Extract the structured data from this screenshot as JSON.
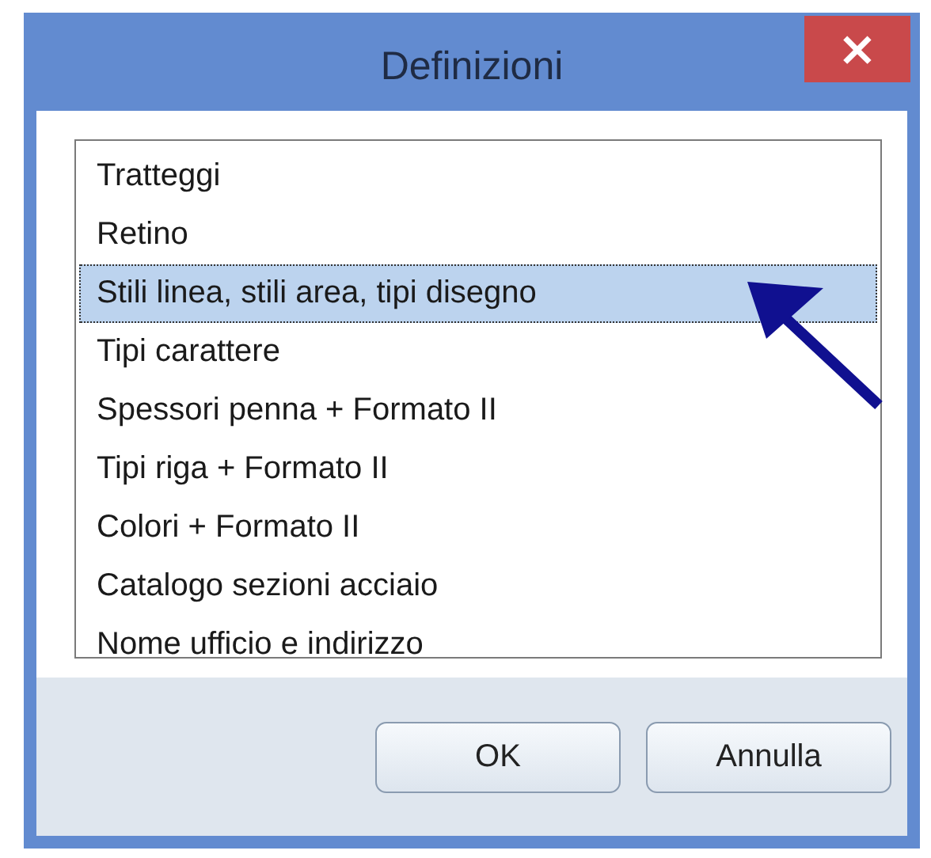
{
  "window": {
    "title": "Definizioni",
    "close": "×"
  },
  "list": {
    "items": [
      {
        "label": "Tratteggi",
        "selected": false
      },
      {
        "label": "Retino",
        "selected": false
      },
      {
        "label": "Stili linea, stili area, tipi disegno",
        "selected": true
      },
      {
        "label": "Tipi carattere",
        "selected": false
      },
      {
        "label": "Spessori penna + Formato II",
        "selected": false
      },
      {
        "label": "Tipi riga + Formato II",
        "selected": false
      },
      {
        "label": "Colori + Formato II",
        "selected": false
      },
      {
        "label": "Catalogo sezioni acciaio",
        "selected": false
      },
      {
        "label": "Nome ufficio e indirizzo",
        "selected": false
      }
    ]
  },
  "buttons": [
    "OK",
    "Annulla"
  ]
}
